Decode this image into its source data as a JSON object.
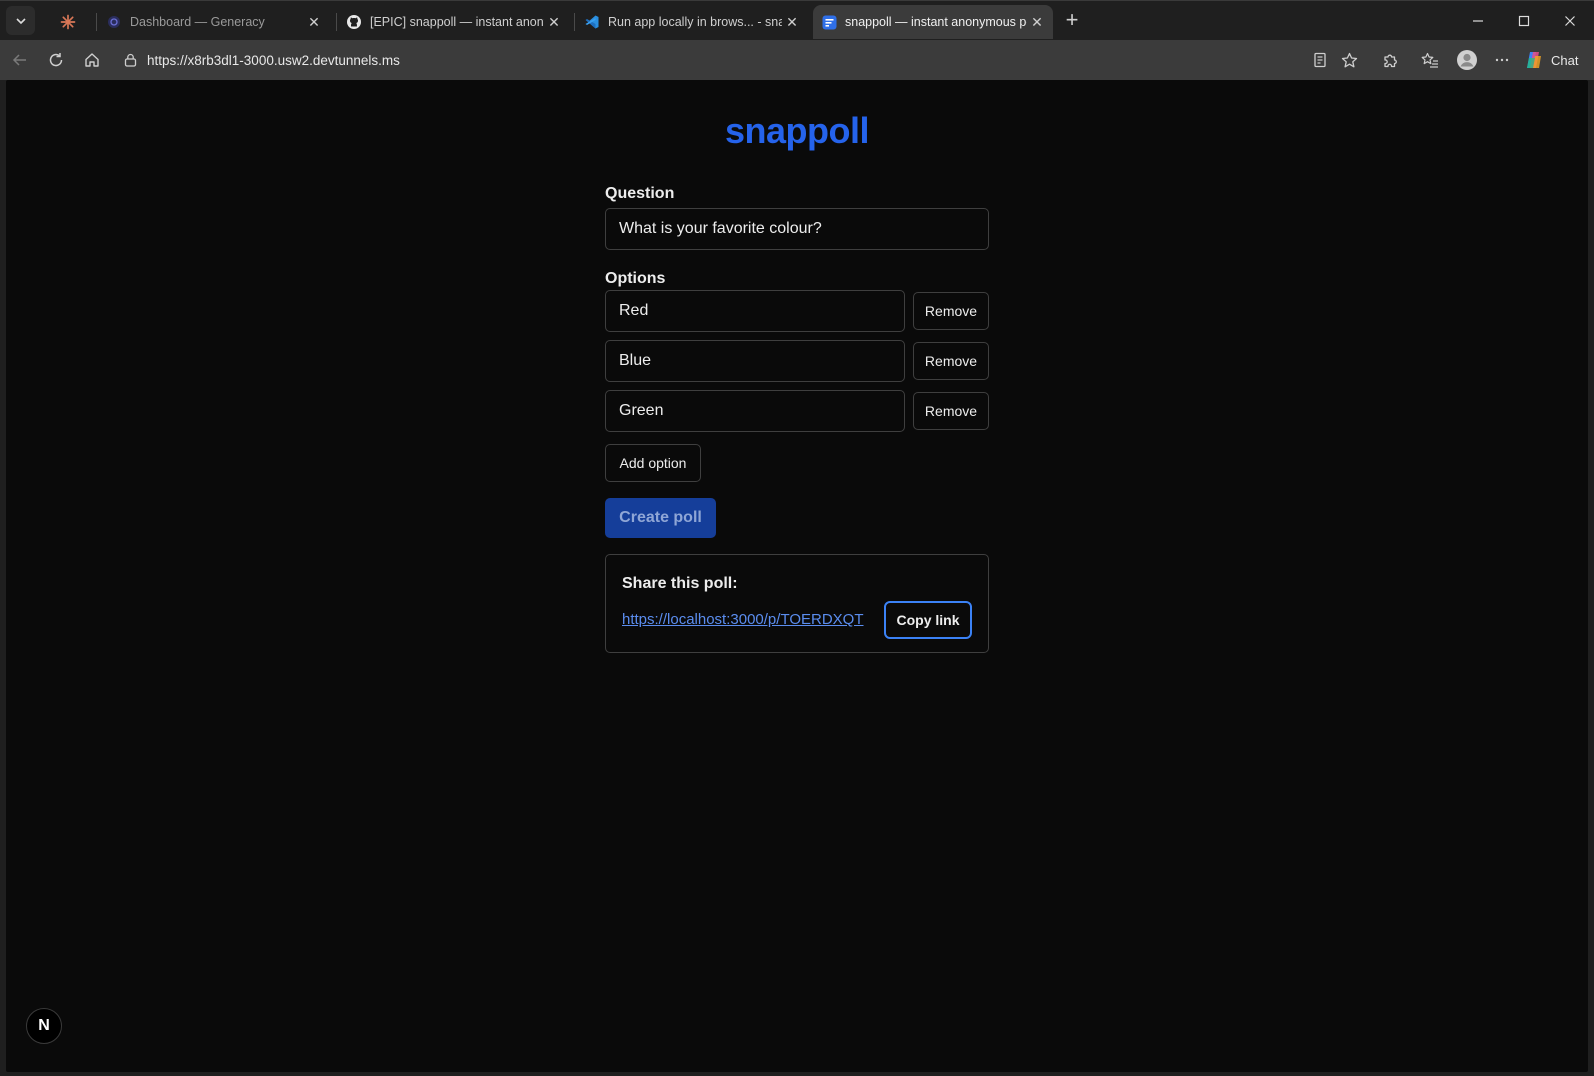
{
  "browser": {
    "tabs": [
      {
        "title": "",
        "icon": "claude-icon",
        "state": "pinned"
      },
      {
        "title": "Dashboard — Generacy",
        "icon": "generacy-icon",
        "state": "inactive"
      },
      {
        "title": "[EPIC] snappoll — instant anonymous",
        "icon": "github-icon",
        "state": "inactive"
      },
      {
        "title": "Run app locally in brows... - snappoll",
        "icon": "vscode-icon",
        "state": "inactive"
      },
      {
        "title": "snappoll — instant anonymous poll",
        "icon": "form-icon",
        "state": "active"
      }
    ],
    "address": "https://x8rb3dl1-3000.usw2.devtunnels.ms",
    "chat_label": "Chat"
  },
  "page": {
    "logo": "snappoll",
    "question_label": "Question",
    "question_value": "What is your favorite colour?",
    "options_label": "Options",
    "options": [
      {
        "value": "Red",
        "remove_label": "Remove"
      },
      {
        "value": "Blue",
        "remove_label": "Remove"
      },
      {
        "value": "Green",
        "remove_label": "Remove"
      }
    ],
    "add_option_label": "Add option",
    "create_poll_label": "Create poll",
    "share": {
      "title": "Share this poll:",
      "link": "https://localhost:3000/p/TOERDXQT",
      "copy_label": "Copy link"
    },
    "dev_badge": "N"
  },
  "colors": {
    "brand": "#2563eb",
    "primary_button": "#153e9a",
    "link": "#5b8def",
    "focus_ring": "#3b82f6",
    "page_background": "#0a0a0a"
  }
}
